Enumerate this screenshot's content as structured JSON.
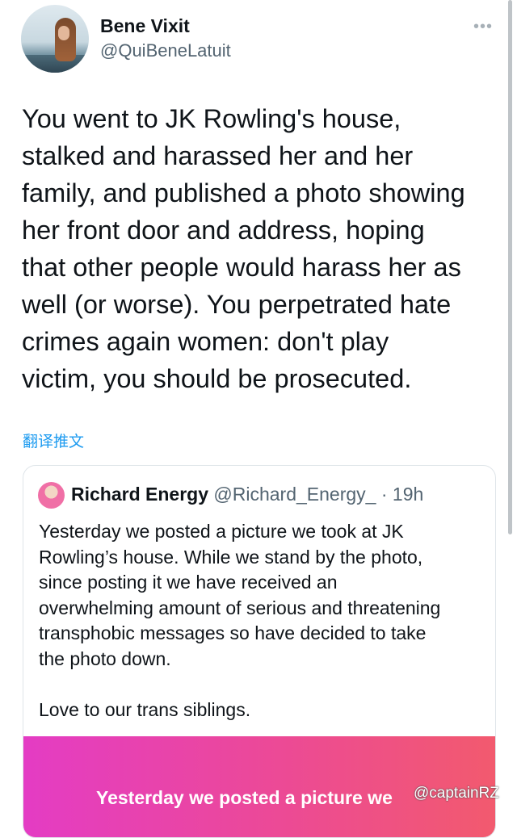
{
  "author": {
    "display_name": "Bene Vixit",
    "handle": "@QuiBeneLatuit",
    "avatar_icon": "profile-photo"
  },
  "more_icon": "•••",
  "tweet_text": "You went to JK Rowling's house,\nstalked and harassed her and her\nfamily, and published a photo showing\nher front door and address, hoping\nthat other people would harass her as\nwell (or worse). You perpetrated hate\ncrimes again women: don't play\nvictim, you should be prosecuted.",
  "translate_label": "翻译推文",
  "quoted_tweet": {
    "display_name": "Richard Energy",
    "handle": "@Richard_Energy_",
    "separator": " · ",
    "time": "19h",
    "text": "Yesterday we posted a picture we took at JK\nRowling’s house. While we stand by the photo,\nsince posting it we have received an\noverwhelming amount of serious and threatening\ntransphobic messages so have decided to take\nthe photo down.\n\nLove to our trans siblings.",
    "image_caption": "Yesterday we posted a picture we"
  },
  "watermark": "@captainRZ",
  "colors": {
    "link": "#1d9bf0",
    "text": "#0f1419",
    "secondary": "#536471",
    "banner_gradient": [
      "#e43cc4",
      "#f25a6e"
    ]
  }
}
